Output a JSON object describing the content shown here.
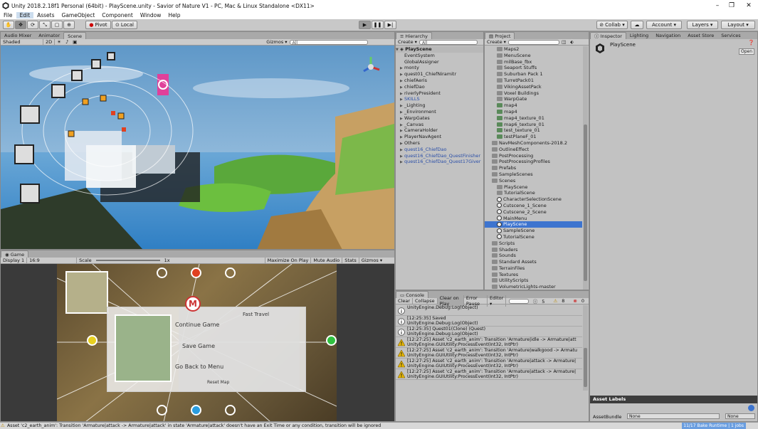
{
  "window": {
    "title": "Unity 2018.2.18f1 Personal (64bit) - PlayScene.unity - Savior of Nature V1 - PC, Mac & Linux Standalone <DX11>",
    "minimize": "–",
    "maximize": "❐",
    "close": "✕"
  },
  "menu": [
    "File",
    "Edit",
    "Assets",
    "GameObject",
    "Component",
    "Window",
    "Help"
  ],
  "toolbar": {
    "pivot": "Pivot",
    "local": "Local",
    "collab": "Collab ▾",
    "account": "Account ▾",
    "layers": "Layers ▾",
    "layout": "Layout ▾"
  },
  "scene": {
    "tabs": [
      "Audio Mixer",
      "Animator",
      "Scene"
    ],
    "shading": "Shaded",
    "mode2d": "2D",
    "gizmos": "Gizmos ▾",
    "search_placeholder": "All"
  },
  "game": {
    "tab": "Game",
    "display": "Display 1",
    "aspect": "16:9",
    "scale_label": "Scale",
    "scale_value": "1x",
    "maximize": "Maximize On Play",
    "mute": "Mute Audio",
    "stats": "Stats",
    "gizmos": "Gizmos ▾",
    "menu_items": [
      "Continue Game",
      "Save Game",
      "Go Back to Menu"
    ],
    "fast_travel": "Fast Travel",
    "reset_map": "Reset Map"
  },
  "hierarchy": {
    "tab": "Hierarchy",
    "create": "Create ▾",
    "search_placeholder": "All",
    "scene": "PlayScene",
    "items": [
      {
        "label": "EventSystem",
        "blue": false,
        "arrow": ""
      },
      {
        "label": "GlobalAssigner",
        "blue": false,
        "arrow": ""
      },
      {
        "label": "monty",
        "blue": false,
        "arrow": "▶"
      },
      {
        "label": "quest01_ChiefNiramitr",
        "blue": false,
        "arrow": "▶"
      },
      {
        "label": "chiefAeris",
        "blue": false,
        "arrow": "▶"
      },
      {
        "label": "chiefDao",
        "blue": false,
        "arrow": "▶"
      },
      {
        "label": "riverlyPresident",
        "blue": false,
        "arrow": "▶"
      },
      {
        "label": "SKILLS",
        "blue": true,
        "arrow": "▶"
      },
      {
        "label": "_Lighting",
        "blue": false,
        "arrow": "▶"
      },
      {
        "label": "_Environment",
        "blue": false,
        "arrow": "▶"
      },
      {
        "label": "WarpGates",
        "blue": false,
        "arrow": "▶"
      },
      {
        "label": "_Canvas",
        "blue": false,
        "arrow": "▶"
      },
      {
        "label": "CameraHolder",
        "blue": false,
        "arrow": "▶"
      },
      {
        "label": "PlayerNavAgent",
        "blue": false,
        "arrow": "▶"
      },
      {
        "label": "Others",
        "blue": false,
        "arrow": "▶"
      },
      {
        "label": "quest16_ChiefDao",
        "blue": true,
        "arrow": "▶"
      },
      {
        "label": "quest16_ChiefDao_QuestFinisher",
        "blue": true,
        "arrow": "▶"
      },
      {
        "label": "quest16_ChiefDao_Quest17Giver",
        "blue": true,
        "arrow": "▶"
      }
    ]
  },
  "project": {
    "tab": "Project",
    "create": "Create ▾",
    "items": [
      {
        "label": "Maps2",
        "indent": 3,
        "type": "folder",
        "sel": false
      },
      {
        "label": "MenuScene",
        "indent": 3,
        "type": "folder",
        "sel": false
      },
      {
        "label": "milBase_fbx",
        "indent": 3,
        "type": "folder",
        "sel": false
      },
      {
        "label": "Seaport Stuffs",
        "indent": 3,
        "type": "folder",
        "sel": false
      },
      {
        "label": "Suburban Pack 1",
        "indent": 3,
        "type": "folder",
        "sel": false
      },
      {
        "label": "TurretPack01",
        "indent": 3,
        "type": "folder",
        "sel": false
      },
      {
        "label": "VikingAssetPack",
        "indent": 3,
        "type": "folder",
        "sel": false
      },
      {
        "label": "Voxel Buildings",
        "indent": 3,
        "type": "folder",
        "sel": false
      },
      {
        "label": "WarpGate",
        "indent": 3,
        "type": "folder",
        "sel": false
      },
      {
        "label": "map4",
        "indent": 3,
        "type": "asset",
        "sel": false
      },
      {
        "label": "map4",
        "indent": 3,
        "type": "asset",
        "sel": false
      },
      {
        "label": "map4_texture_01",
        "indent": 3,
        "type": "asset",
        "sel": false
      },
      {
        "label": "map6_texture_01",
        "indent": 3,
        "type": "asset",
        "sel": false
      },
      {
        "label": "test_texture_01",
        "indent": 3,
        "type": "asset",
        "sel": false
      },
      {
        "label": "testPlaneF_01",
        "indent": 3,
        "type": "asset",
        "sel": false
      },
      {
        "label": "NavMeshComponents-2018.2",
        "indent": 2,
        "type": "folder",
        "sel": false
      },
      {
        "label": "OutlineEffect",
        "indent": 2,
        "type": "folder",
        "sel": false
      },
      {
        "label": "PostProcessing",
        "indent": 2,
        "type": "folder",
        "sel": false
      },
      {
        "label": "PostProcessingProfiles",
        "indent": 2,
        "type": "folder",
        "sel": false
      },
      {
        "label": "Prefabs",
        "indent": 2,
        "type": "folder",
        "sel": false
      },
      {
        "label": "SampleScenes",
        "indent": 2,
        "type": "folder",
        "sel": false
      },
      {
        "label": "Scenes",
        "indent": 2,
        "type": "folder",
        "sel": false
      },
      {
        "label": "PlayScene",
        "indent": 3,
        "type": "folder",
        "sel": false
      },
      {
        "label": "TutorialScene",
        "indent": 3,
        "type": "folder",
        "sel": false
      },
      {
        "label": "CharacterSelectionScene",
        "indent": 3,
        "type": "scene",
        "sel": false
      },
      {
        "label": "Cutscene_1_Scene",
        "indent": 3,
        "type": "scene",
        "sel": false
      },
      {
        "label": "Cutscene_2_Scene",
        "indent": 3,
        "type": "scene",
        "sel": false
      },
      {
        "label": "MainMenu",
        "indent": 3,
        "type": "scene",
        "sel": false
      },
      {
        "label": "PlayScene",
        "indent": 3,
        "type": "scene",
        "sel": true
      },
      {
        "label": "SampleScene",
        "indent": 3,
        "type": "scene",
        "sel": false
      },
      {
        "label": "TutorialScene",
        "indent": 3,
        "type": "scene",
        "sel": false
      },
      {
        "label": "Scripts",
        "indent": 2,
        "type": "folder",
        "sel": false
      },
      {
        "label": "Shaders",
        "indent": 2,
        "type": "folder",
        "sel": false
      },
      {
        "label": "Sounds",
        "indent": 2,
        "type": "folder",
        "sel": false
      },
      {
        "label": "Standard Assets",
        "indent": 2,
        "type": "folder",
        "sel": false
      },
      {
        "label": "TerrainFiles",
        "indent": 2,
        "type": "folder",
        "sel": false
      },
      {
        "label": "Textures",
        "indent": 2,
        "type": "folder",
        "sel": false
      },
      {
        "label": "UtilityScripts",
        "indent": 2,
        "type": "folder",
        "sel": false
      },
      {
        "label": "VolumetricLights-master",
        "indent": 2,
        "type": "folder",
        "sel": false
      }
    ]
  },
  "inspector": {
    "tabs": [
      "Inspector",
      "Lighting",
      "Navigation",
      "Asset Store",
      "Services"
    ],
    "object": "PlayScene",
    "open": "Open",
    "asset_labels": "Asset Labels",
    "asset_bundle": "AssetBundle",
    "none1": "None",
    "none2": "None"
  },
  "console": {
    "tab": "Console",
    "buttons": [
      "Clear",
      "Collapse",
      "Clear on Play",
      "Error Pause",
      "Editor ▾"
    ],
    "counts": {
      "info": "5",
      "warn": "8",
      "err": "0"
    },
    "rows": [
      {
        "type": "info",
        "l1": "UnityEngine.Debug:Log(Object)",
        "l2": ""
      },
      {
        "type": "info",
        "l1": "[12:25:35] Saved",
        "l2": "UnityEngine.Debug:Log(Object)"
      },
      {
        "type": "info",
        "l1": "[12:25:35] Quest01(Clone) (Quest)",
        "l2": "UnityEngine.Debug:Log(Object)"
      },
      {
        "type": "warn",
        "l1": "[12:27:25] Asset 'c2_earth_anim': Transition 'Armature|idle -> Armature|att",
        "l2": "UnityEngine.GUIUtility:ProcessEvent(Int32, IntPtr)"
      },
      {
        "type": "warn",
        "l1": "[12:27:25] Asset 'c2_earth_anim': Transition 'Armature|walkgood -> Armatu",
        "l2": "UnityEngine.GUIUtility:ProcessEvent(Int32, IntPtr)"
      },
      {
        "type": "warn",
        "l1": "[12:27:25] Asset 'c2_earth_anim': Transition 'Armature|attack -> Armature|",
        "l2": "UnityEngine.GUIUtility:ProcessEvent(Int32, IntPtr)"
      },
      {
        "type": "warn",
        "l1": "[12:27:25] Asset 'c2_earth_anim': Transition 'Armature|attack -> Armature|",
        "l2": "UnityEngine.GUIUtility:ProcessEvent(Int32, IntPtr)"
      }
    ]
  },
  "status": {
    "message": "Asset 'c2_earth_anim': Transition 'Armature|attack -> Armature|attack' in state 'Armature|attack' doesn't have an Exit Time or any condition, transition will be ignored",
    "bake": "11/17 Bake Runtime | 1 jobs"
  },
  "colors": {
    "selection": "#3d74cf",
    "warn": "#e8b800",
    "panel": "#c2c2c2"
  }
}
